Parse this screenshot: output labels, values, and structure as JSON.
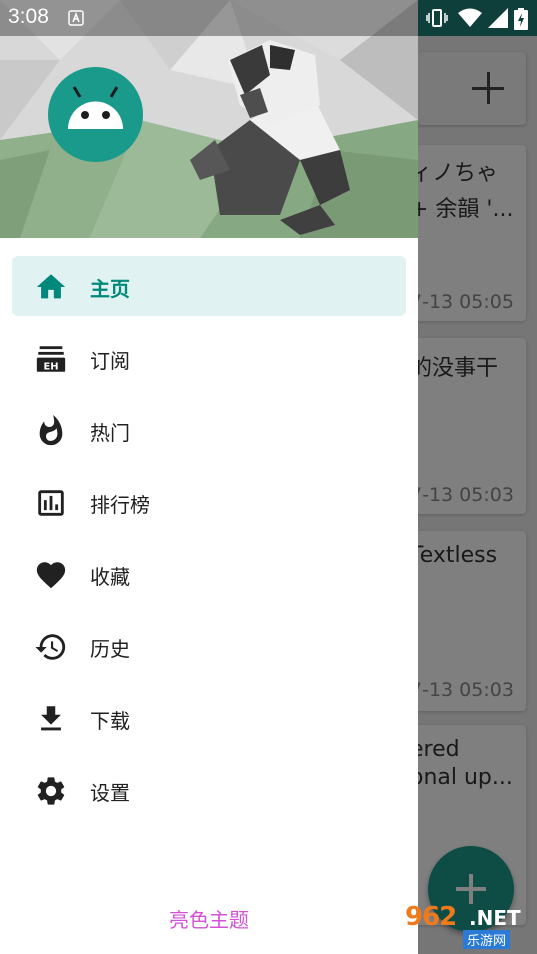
{
  "status_bar": {
    "time": "3:08"
  },
  "drawer": {
    "menu": [
      {
        "label": "主页",
        "icon": "home-icon",
        "active": true
      },
      {
        "label": "订阅",
        "icon": "subscriptions-icon",
        "active": false
      },
      {
        "label": "热门",
        "icon": "whatshot-icon",
        "active": false
      },
      {
        "label": "排行榜",
        "icon": "ranking-icon",
        "active": false
      },
      {
        "label": "收藏",
        "icon": "heart-icon",
        "active": false
      },
      {
        "label": "历史",
        "icon": "history-icon",
        "active": false
      },
      {
        "label": "下载",
        "icon": "download-icon",
        "active": false
      },
      {
        "label": "设置",
        "icon": "gear-icon",
        "active": false
      }
    ],
    "theme_toggle": "亮色主题"
  },
  "background": {
    "cards": [
      {
        "title_line1": "ィノちゃ",
        "title_line2": "+ 余韻 '...",
        "date": "7-13 05:05"
      },
      {
        "title_line1": "的没事干",
        "title_line2": "",
        "date": "7-13 05:03"
      },
      {
        "title_line1": "Textless",
        "title_line2": "",
        "date": "7-13 05:03"
      },
      {
        "title_line1": "ered",
        "title_line2": "onal up...",
        "date": ""
      }
    ]
  },
  "watermark": {
    "number": "962",
    "suffix": ".NET",
    "subtitle": "乐游网"
  },
  "colors": {
    "accent": "#00897b",
    "active_bg": "#e0f2f1",
    "theme_toggle": "#d252d8",
    "fab": "#1b9a8c"
  }
}
